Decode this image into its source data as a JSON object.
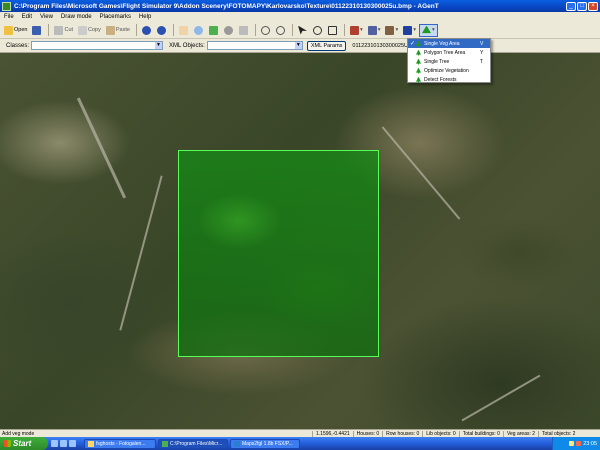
{
  "window": {
    "title": "C:\\Program Files\\Microsoft Games\\Flight Simulator 9\\Addon Scenery\\FOTOMAPY\\Karlovarsko\\Texture\\01122310130300025u.bmp - AGenT"
  },
  "menu": [
    "File",
    "Edit",
    "View",
    "Draw mode",
    "Placemarks",
    "Help"
  ],
  "toolbar": {
    "open_label": "Open",
    "cut_label": "Cut",
    "copy_label": "Copy",
    "paste_label": "Paste"
  },
  "classbar": {
    "classes_label": "Classes:",
    "xml_objects_label": "XML Objects:",
    "xml_params_label": "XML Params",
    "file_text": "01122310130300025Un.sgn"
  },
  "dropdown": [
    {
      "label": "Single Veg Area",
      "key": "V",
      "checked": true
    },
    {
      "label": "Polygon Tree Area",
      "key": "Y",
      "checked": false
    },
    {
      "label": "Single Tree",
      "key": "T",
      "checked": false
    },
    {
      "label": "Optimize Vegetation",
      "key": "",
      "checked": false
    },
    {
      "label": "Detect Forests",
      "key": "",
      "checked": false
    }
  ],
  "status": {
    "mode": "Add veg mode",
    "coords": "1.1596,-0.4421",
    "houses": "Houses: 0",
    "row_houses": "Row houses: 0",
    "lib_objects": "Lib objects: 0",
    "total_buildings": "Total buildings: 0",
    "veg_areas": "Veg areas: 2",
    "total_objects": "Total objects: 2"
  },
  "taskbar": {
    "start_label": "Start",
    "tasks": [
      "fsghosts - Fotogalen...",
      "C:\\Program Files\\Micr...",
      "Maps2fgl 1.8b FSX/P..."
    ],
    "clock": "23:05"
  },
  "colors": {
    "title_bar": "#0a5fe0",
    "veg_area_border": "#58ff58",
    "menu_highlight": "#316ac5"
  }
}
